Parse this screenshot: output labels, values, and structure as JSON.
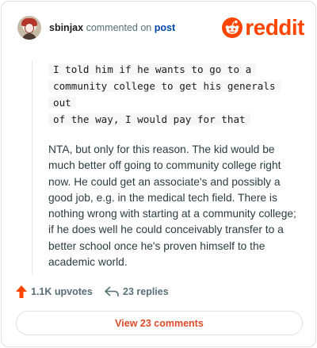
{
  "header": {
    "username": "sbinjax",
    "action_text": "commented on",
    "post_link": "post",
    "brand": "reddit"
  },
  "comment": {
    "quote_lines": [
      "I told him if he wants to go to a",
      "community college to get his generals out",
      "of the way, I would pay for that"
    ],
    "body": "NTA, but only for this reason. The kid would be much better off going to community college right now. He could get an associate's and possibly a good job, e.g. in the medical tech field. There is nothing wrong with starting at a community college; if he does well he could conceivably transfer to a better school once he's proven himself to the academic world."
  },
  "actions": {
    "upvotes": "1.1K upvotes",
    "replies": "23 replies"
  },
  "footer": {
    "view_comments": "View 23 comments"
  },
  "colors": {
    "brand": "#ff4500",
    "link": "#0045ac",
    "muted": "#576f76",
    "button_text": "#e04b2a"
  },
  "icons": [
    "avatar",
    "reddit-logo-icon",
    "upvote-arrow-icon",
    "reply-arrow-icon"
  ]
}
